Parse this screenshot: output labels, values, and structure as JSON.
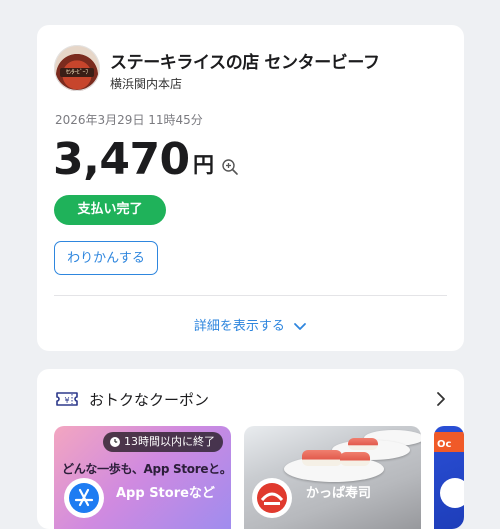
{
  "receipt": {
    "store_name": "ステーキライスの店 センタービーフ",
    "store_branch": "横浜関内本店",
    "logo_text": "ｾﾝﾀｰﾋﾞｰﾌ",
    "timestamp": "2026年3月29日 11時45分",
    "amount": "3,470",
    "currency": "円",
    "status": "支払い完了",
    "unsure_button": "わりかんする",
    "details_link": "詳細を表示する"
  },
  "coupons": {
    "title": "おトクなクーポン",
    "tiles": [
      {
        "timer": "13時間以内に終了",
        "headline": "どんな一歩も、App Storeと。",
        "brand": "App Storeなど"
      },
      {
        "brand": "かっぱ寿司"
      },
      {
        "tag": "Oc"
      }
    ]
  },
  "colors": {
    "accent_blue": "#2e86de",
    "success_green": "#1fb25a",
    "background": "#eef0f3"
  },
  "icons": [
    "zoom-in-icon",
    "chevron-down-icon",
    "coupon-ticket-icon",
    "chevron-right-icon",
    "clock-icon",
    "app-store-icon",
    "kappa-sushi-icon"
  ]
}
